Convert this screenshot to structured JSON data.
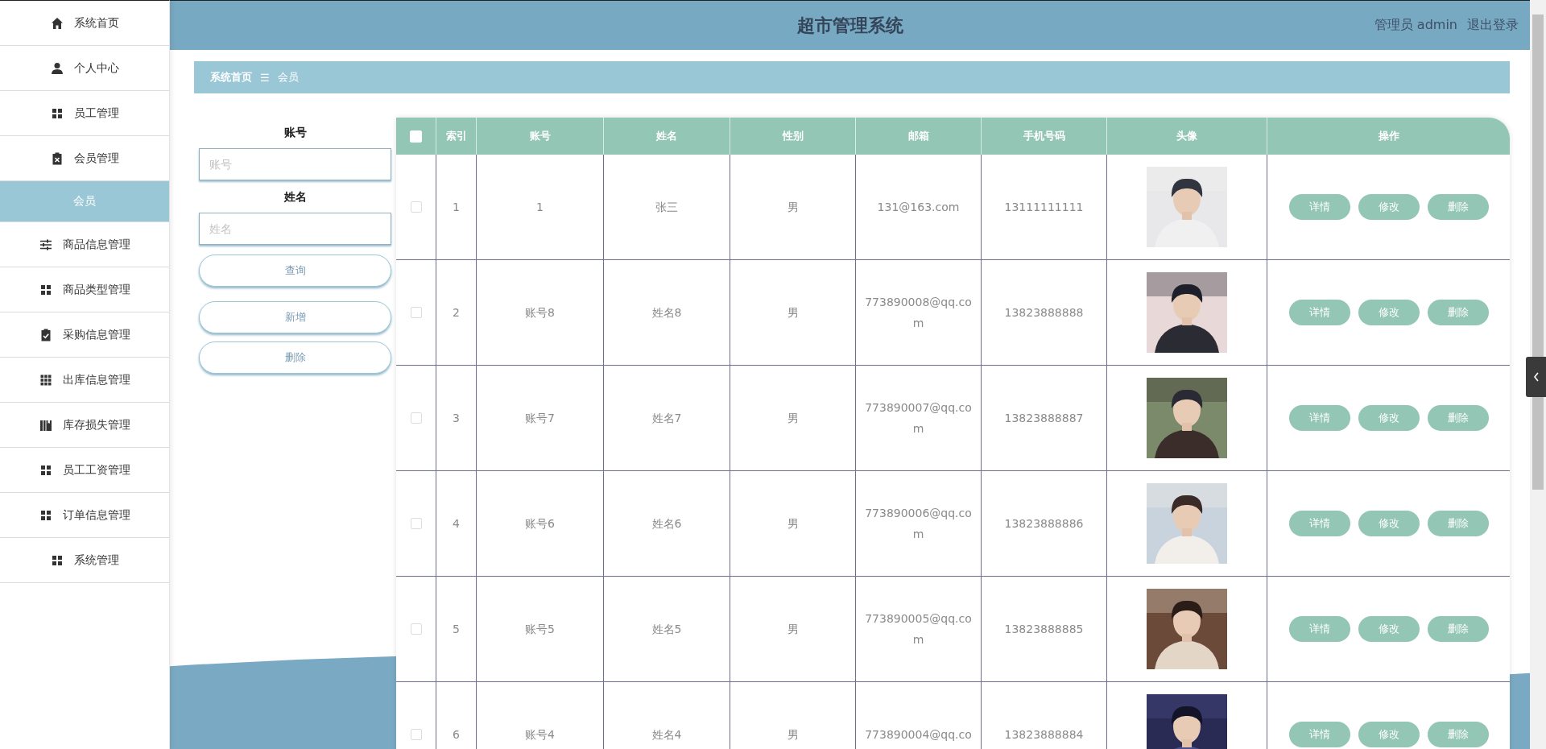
{
  "header": {
    "title": "超市管理系统",
    "user": "管理员 admin",
    "logout": "退出登录"
  },
  "sidebar": {
    "items": [
      {
        "label": "系统首页",
        "kind": "home",
        "selected": false
      },
      {
        "label": "个人中心",
        "kind": "user",
        "selected": false
      },
      {
        "label": "员工管理",
        "kind": "grid",
        "selected": false
      },
      {
        "label": "会员管理",
        "kind": "clipboard",
        "selected": false,
        "children": [
          {
            "label": "会员",
            "selected": true
          }
        ]
      },
      {
        "label": "商品信息管理",
        "kind": "sliders",
        "selected": false
      },
      {
        "label": "商品类型管理",
        "kind": "grid",
        "selected": false
      },
      {
        "label": "采购信息管理",
        "kind": "check",
        "selected": false
      },
      {
        "label": "出库信息管理",
        "kind": "grid9",
        "selected": false
      },
      {
        "label": "库存损失管理",
        "kind": "book",
        "selected": false
      },
      {
        "label": "员工工资管理",
        "kind": "grid",
        "selected": false
      },
      {
        "label": "订单信息管理",
        "kind": "grid",
        "selected": false
      },
      {
        "label": "系统管理",
        "kind": "grid",
        "selected": false
      }
    ]
  },
  "breadcrumb": {
    "items": [
      "系统首页",
      "会员"
    ],
    "separator": "☰"
  },
  "search": {
    "fields": [
      {
        "label": "账号",
        "placeholder": "账号"
      },
      {
        "label": "姓名",
        "placeholder": "姓名"
      }
    ],
    "query_button": "查询",
    "buttons": [
      "新增",
      "删除"
    ]
  },
  "table": {
    "select_all": {
      "checked": false
    },
    "columns": [
      "索引",
      "账号",
      "姓名",
      "性别",
      "邮箱",
      "手机号码",
      "头像",
      "操作"
    ],
    "rows": [
      {
        "checked": false,
        "index": "1",
        "account": "1",
        "name": "张三",
        "gender": "男",
        "email": "131@163.com",
        "phone": "13111111111",
        "actions": [
          "详情",
          "修改",
          "删除"
        ]
      },
      {
        "checked": false,
        "index": "2",
        "account": "账号8",
        "name": "姓名8",
        "gender": "男",
        "email": "773890008@qq.com",
        "phone": "13823888888",
        "actions": [
          "详情",
          "修改",
          "删除"
        ]
      },
      {
        "checked": false,
        "index": "3",
        "account": "账号7",
        "name": "姓名7",
        "gender": "男",
        "email": "773890007@qq.com",
        "phone": "13823888887",
        "actions": [
          "详情",
          "修改",
          "删除"
        ]
      },
      {
        "checked": false,
        "index": "4",
        "account": "账号6",
        "name": "姓名6",
        "gender": "男",
        "email": "773890006@qq.com",
        "phone": "13823888886",
        "actions": [
          "详情",
          "修改",
          "删除"
        ]
      },
      {
        "checked": false,
        "index": "5",
        "account": "账号5",
        "name": "姓名5",
        "gender": "男",
        "email": "773890005@qq.com",
        "phone": "13823888885",
        "actions": [
          "详情",
          "修改",
          "删除"
        ]
      },
      {
        "checked": false,
        "index": "6",
        "account": "账号4",
        "name": "姓名4",
        "gender": "男",
        "email": "773890004@qq.co",
        "phone": "13823888884",
        "actions": [
          "详情",
          "修改",
          "删除"
        ]
      }
    ]
  }
}
